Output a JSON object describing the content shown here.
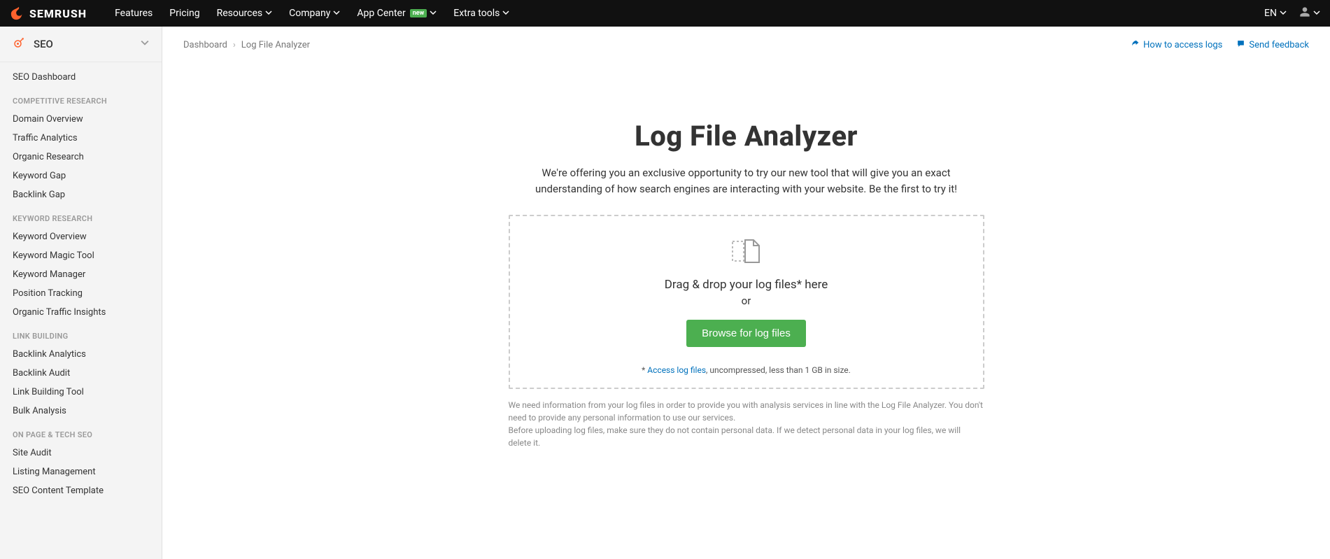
{
  "topnav": {
    "brand": "SEMRUSH",
    "items": [
      {
        "label": "Features",
        "dropdown": false
      },
      {
        "label": "Pricing",
        "dropdown": false
      },
      {
        "label": "Resources",
        "dropdown": true
      },
      {
        "label": "Company",
        "dropdown": true
      },
      {
        "label": "App Center",
        "dropdown": true,
        "badge": "new"
      },
      {
        "label": "Extra tools",
        "dropdown": true
      }
    ],
    "lang": "EN"
  },
  "sidebar": {
    "header": "SEO",
    "top_item": "SEO Dashboard",
    "sections": [
      {
        "title": "COMPETITIVE RESEARCH",
        "items": [
          "Domain Overview",
          "Traffic Analytics",
          "Organic Research",
          "Keyword Gap",
          "Backlink Gap"
        ]
      },
      {
        "title": "KEYWORD RESEARCH",
        "items": [
          "Keyword Overview",
          "Keyword Magic Tool",
          "Keyword Manager",
          "Position Tracking",
          "Organic Traffic Insights"
        ]
      },
      {
        "title": "LINK BUILDING",
        "items": [
          "Backlink Analytics",
          "Backlink Audit",
          "Link Building Tool",
          "Bulk Analysis"
        ]
      },
      {
        "title": "ON PAGE & TECH SEO",
        "items": [
          "Site Audit",
          "Listing Management",
          "SEO Content Template"
        ]
      }
    ]
  },
  "breadcrumb": {
    "root": "Dashboard",
    "current": "Log File Analyzer"
  },
  "header_actions": {
    "how_to": "How to access logs",
    "feedback": "Send feedback"
  },
  "hero": {
    "title": "Log File Analyzer",
    "desc": "We're offering you an exclusive opportunity to try our new tool that will give you an exact understanding of how search engines are interacting with your website. Be the first to try it!"
  },
  "dropzone": {
    "drag_text": "Drag & drop your log files* here",
    "or": "or",
    "button": "Browse for log files",
    "footnote_prefix": "* ",
    "footnote_link": "Access log files",
    "footnote_suffix": ", uncompressed, less than 1 GB in size."
  },
  "disclaimer": {
    "p1": "We need information from your log files in order to provide you with analysis services in line with the Log File Analyzer. You don't need to provide any personal information to use our services.",
    "p2": "Before uploading log files, make sure they do not contain personal data. If we detect personal data in your log files, we will delete it."
  }
}
